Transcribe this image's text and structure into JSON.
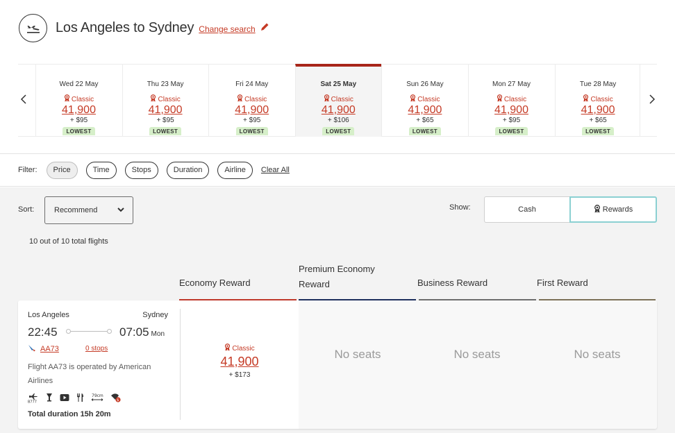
{
  "header": {
    "icon": "plane-departure-icon",
    "title": "Los Angeles to Sydney",
    "change_search": "Change search",
    "edit_icon": "pencil-icon"
  },
  "calendar": {
    "prev_icon": "chevron-left-icon",
    "next_icon": "chevron-right-icon",
    "days": [
      {
        "date": "Wed 22 May",
        "fare_type": "Classic",
        "points": "41,900",
        "tax": "+ $95",
        "badge": "LOWEST",
        "selected": false
      },
      {
        "date": "Thu 23 May",
        "fare_type": "Classic",
        "points": "41,900",
        "tax": "+ $95",
        "badge": "LOWEST",
        "selected": false
      },
      {
        "date": "Fri 24 May",
        "fare_type": "Classic",
        "points": "41,900",
        "tax": "+ $95",
        "badge": "LOWEST",
        "selected": false
      },
      {
        "date": "Sat 25 May",
        "fare_type": "Classic",
        "points": "41,900",
        "tax": "+ $106",
        "badge": "LOWEST",
        "selected": true
      },
      {
        "date": "Sun 26 May",
        "fare_type": "Classic",
        "points": "41,900",
        "tax": "+ $65",
        "badge": "LOWEST",
        "selected": false
      },
      {
        "date": "Mon 27 May",
        "fare_type": "Classic",
        "points": "41,900",
        "tax": "+ $95",
        "badge": "LOWEST",
        "selected": false
      },
      {
        "date": "Tue 28 May",
        "fare_type": "Classic",
        "points": "41,900",
        "tax": "+ $65",
        "badge": "LOWEST",
        "selected": false
      }
    ]
  },
  "filters": {
    "label": "Filter:",
    "chips": [
      {
        "label": "Price",
        "active": true
      },
      {
        "label": "Time",
        "active": false
      },
      {
        "label": "Stops",
        "active": false
      },
      {
        "label": "Duration",
        "active": false
      },
      {
        "label": "Airline",
        "active": false
      }
    ],
    "clear_all": "Clear All"
  },
  "sort": {
    "label": "Sort:",
    "selected": "Recommend"
  },
  "results_count": "10 out of 10 total flights",
  "show": {
    "label": "Show:",
    "options": [
      "Cash",
      "Rewards"
    ],
    "selected": "Rewards"
  },
  "cabins": [
    {
      "label": "Economy Reward",
      "color": "#c0392b"
    },
    {
      "label": "Premium Economy Reward",
      "color": "#1e2f5e"
    },
    {
      "label": "Business Reward",
      "color": "#6e6e6e"
    },
    {
      "label": "First Reward",
      "color": "#7d7158"
    }
  ],
  "flight": {
    "origin": "Los Angeles",
    "destination": "Sydney",
    "depart_time": "22:45",
    "arrive_time": "07:05",
    "arrive_day": "Mon",
    "flight_number": "AA73",
    "stops": "0 stops",
    "operated_by": "Flight AA73 is operated by American Airlines",
    "aircraft": "B777",
    "seat_pitch": "79cm",
    "amenities": [
      "aircraft-b777-icon",
      "bar-icon",
      "entertainment-icon",
      "meal-icon",
      "seat-pitch-icon",
      "paid-wifi-icon"
    ],
    "total_duration": "Total duration 15h 20m",
    "fares": [
      {
        "cabin": "Economy Reward",
        "fare_type": "Classic",
        "points": "41,900",
        "tax": "+ $173"
      },
      {
        "cabin": "Premium Economy Reward",
        "status": "No seats"
      },
      {
        "cabin": "Business Reward",
        "status": "No seats"
      },
      {
        "cabin": "First Reward",
        "status": "No seats"
      }
    ]
  },
  "colors": {
    "accent_red": "#c53a25",
    "selected_day_bar": "#a8261a",
    "lowest_badge": "#d6efc9",
    "rewards_outline": "#8bd0d2"
  }
}
